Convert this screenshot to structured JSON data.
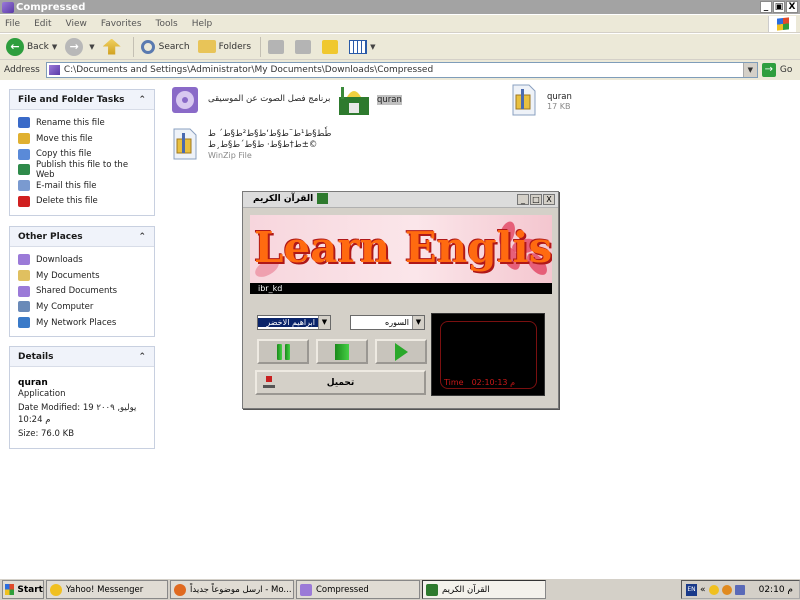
{
  "window": {
    "title": "Compressed",
    "buttons": [
      "_",
      "▣",
      "X"
    ]
  },
  "menu": [
    "File",
    "Edit",
    "View",
    "Favorites",
    "Tools",
    "Help"
  ],
  "toolbar": {
    "back_label": "Back",
    "search_label": "Search",
    "folders_label": "Folders"
  },
  "address": {
    "label": "Address",
    "path": "C:\\Documents and Settings\\Administrator\\My Documents\\Downloads\\Compressed",
    "go_label": "Go"
  },
  "tasks_panel": {
    "title": "File and Folder Tasks",
    "items": [
      {
        "label": "Rename this file",
        "icon": "rename-icon",
        "color": "#3a6ac8"
      },
      {
        "label": "Move this file",
        "icon": "move-icon",
        "color": "#e0b030"
      },
      {
        "label": "Copy this file",
        "icon": "copy-icon",
        "color": "#5a8ad8"
      },
      {
        "label": "Publish this file to the Web",
        "icon": "globe-icon",
        "color": "#2e8a4a"
      },
      {
        "label": "E-mail this file",
        "icon": "mail-icon",
        "color": "#7a9ad0"
      },
      {
        "label": "Delete this file",
        "icon": "delete-icon",
        "color": "#d02020"
      }
    ]
  },
  "places_panel": {
    "title": "Other Places",
    "items": [
      {
        "label": "Downloads",
        "icon": "folder-icon",
        "color": "#9b7ad8"
      },
      {
        "label": "My Documents",
        "icon": "documents-icon",
        "color": "#e0c060"
      },
      {
        "label": "Shared Documents",
        "icon": "shared-folder-icon",
        "color": "#9b7ad8"
      },
      {
        "label": "My Computer",
        "icon": "computer-icon",
        "color": "#6a8ab8"
      },
      {
        "label": "My Network Places",
        "icon": "network-icon",
        "color": "#3a7ac8"
      }
    ]
  },
  "details_panel": {
    "title": "Details",
    "name": "quran",
    "type": "Application",
    "modified": "Date Modified: 19 يوليو, ٢٠٠٩",
    "modified_time": "10:24 م",
    "size": "Size: 76.0 KB"
  },
  "files": [
    {
      "name": "برنامج فصل الصوت عن الموسيقى",
      "sub": ""
    },
    {
      "name": "quran",
      "sub": ""
    },
    {
      "name": "quran",
      "sub": "17 KB"
    },
    {
      "name": "طٗط§ط¹ط¨ط§ط‘ط§ط²ط§ط´ ط±ط†ط§ط· ط§ط´ط§ط¸ط©",
      "sub": "WinZip File"
    }
  ],
  "dialog": {
    "title": "القرآن الكريم",
    "buttons": [
      "_",
      "□",
      "X"
    ],
    "banner_text": "Learn English",
    "strip_text": "ibr_kd",
    "reciter_select": "ابراهيم الاخضر",
    "surah_select": "السوره",
    "load_label": "تحميل",
    "time_label": "Time",
    "time_value": "02:10:13 م"
  },
  "taskbar": {
    "start_label": "Start",
    "tasks": [
      {
        "label": "Yahoo! Messenger",
        "color": "#f0c020"
      },
      {
        "label": "ارسل موضوعاً جديداً - Mo...",
        "color": "#e06a20"
      },
      {
        "label": "Compressed",
        "color": "#9b7ad8"
      },
      {
        "label": "القرآن الكريم",
        "color": "#2e7a2e"
      }
    ],
    "lang": "EN",
    "clock": "02:10 م"
  }
}
